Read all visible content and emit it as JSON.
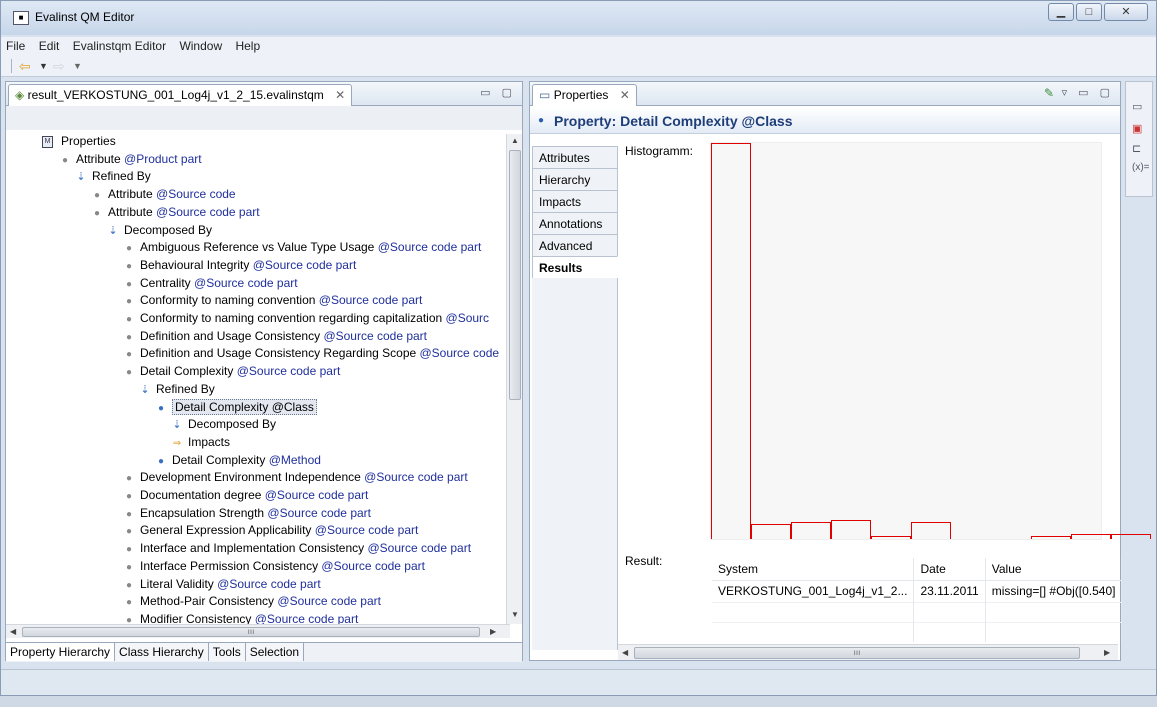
{
  "window": {
    "title": "Evalinst QM Editor"
  },
  "menu": [
    "File",
    "Edit",
    "Evalinstqm Editor",
    "Window",
    "Help"
  ],
  "left_panel": {
    "tab_label": "result_VERKOSTUNG_001_Log4j_v1_2_15.evalinstqm",
    "tree": [
      {
        "indent": 0,
        "icon": "prop",
        "text": "Properties",
        "at": ""
      },
      {
        "indent": 1,
        "icon": "dot",
        "text": "Attribute ",
        "at": "@Product part"
      },
      {
        "indent": 2,
        "icon": "ref",
        "text": "Refined By",
        "at": ""
      },
      {
        "indent": 3,
        "icon": "dot",
        "text": "Attribute ",
        "at": "@Source code"
      },
      {
        "indent": 3,
        "icon": "dot",
        "text": "Attribute ",
        "at": "@Source code part"
      },
      {
        "indent": 4,
        "icon": "ref",
        "text": "Decomposed By",
        "at": ""
      },
      {
        "indent": 5,
        "icon": "dot",
        "text": "Ambiguous Reference vs Value Type Usage ",
        "at": "@Source code part"
      },
      {
        "indent": 5,
        "icon": "dot",
        "text": "Behavioural Integrity ",
        "at": "@Source code part"
      },
      {
        "indent": 5,
        "icon": "dot",
        "text": "Centrality ",
        "at": "@Source code part"
      },
      {
        "indent": 5,
        "icon": "dot",
        "text": "Conformity to naming convention ",
        "at": "@Source code part"
      },
      {
        "indent": 5,
        "icon": "dot",
        "text": "Conformity to naming convention regarding capitalization ",
        "at": "@Sourc"
      },
      {
        "indent": 5,
        "icon": "dot",
        "text": "Definition and Usage Consistency ",
        "at": "@Source code part"
      },
      {
        "indent": 5,
        "icon": "dot",
        "text": "Definition and Usage Consistency Regarding Scope ",
        "at": "@Source code"
      },
      {
        "indent": 5,
        "icon": "dot",
        "text": "Detail Complexity ",
        "at": "@Source code part"
      },
      {
        "indent": 6,
        "icon": "ref",
        "text": "Refined By",
        "at": ""
      },
      {
        "indent": 7,
        "icon": "sel",
        "text": "Detail Complexity @Class",
        "at": "",
        "selected": true
      },
      {
        "indent": 8,
        "icon": "ref",
        "text": "Decomposed By",
        "at": ""
      },
      {
        "indent": 8,
        "icon": "imp",
        "text": "Impacts",
        "at": ""
      },
      {
        "indent": 7,
        "icon": "sel",
        "text": "Detail Complexity ",
        "at": "@Method"
      },
      {
        "indent": 5,
        "icon": "dot",
        "text": "Development Environment Independence ",
        "at": "@Source code part"
      },
      {
        "indent": 5,
        "icon": "dot",
        "text": "Documentation degree ",
        "at": "@Source code part"
      },
      {
        "indent": 5,
        "icon": "dot",
        "text": "Encapsulation Strength ",
        "at": "@Source code part"
      },
      {
        "indent": 5,
        "icon": "dot",
        "text": "General Expression Applicability ",
        "at": "@Source code part"
      },
      {
        "indent": 5,
        "icon": "dot",
        "text": "Interface and Implementation Consistency ",
        "at": "@Source code part"
      },
      {
        "indent": 5,
        "icon": "dot",
        "text": "Interface Permission Consistency ",
        "at": "@Source code part"
      },
      {
        "indent": 5,
        "icon": "dot",
        "text": "Literal Validity ",
        "at": "@Source code part"
      },
      {
        "indent": 5,
        "icon": "dot",
        "text": "Method-Pair Consistency  ",
        "at": "@Source code part"
      },
      {
        "indent": 5,
        "icon": "dot",
        "text": "Modifier Consistency ",
        "at": "@Source code part"
      }
    ],
    "bottom_tabs": [
      "Property Hierarchy",
      "Class Hierarchy",
      "Tools",
      "Selection"
    ]
  },
  "right_panel": {
    "tab_label": "Properties",
    "title": "Property: Detail Complexity @Class",
    "side_tabs": [
      "Attributes",
      "Hierarchy",
      "Impacts",
      "Annotations",
      "Advanced",
      "Results"
    ],
    "active_tab": "Results",
    "histogram_label": "Histogramm:",
    "result_label": "Result:",
    "columns": [
      "System",
      "Date",
      "Value"
    ],
    "rows": [
      [
        "VERKOSTUNG_001_Log4j_v1_2...",
        "23.11.2011",
        "missing=[] #Obj([0.540]"
      ]
    ]
  },
  "chart_data": {
    "type": "bar",
    "values": [
      1.0,
      0.038,
      0.043,
      0.048,
      0.008,
      0.043,
      0.0,
      0.0,
      0.008,
      0.013,
      0.013
    ],
    "title": "",
    "xlabel": "",
    "ylabel": ""
  }
}
